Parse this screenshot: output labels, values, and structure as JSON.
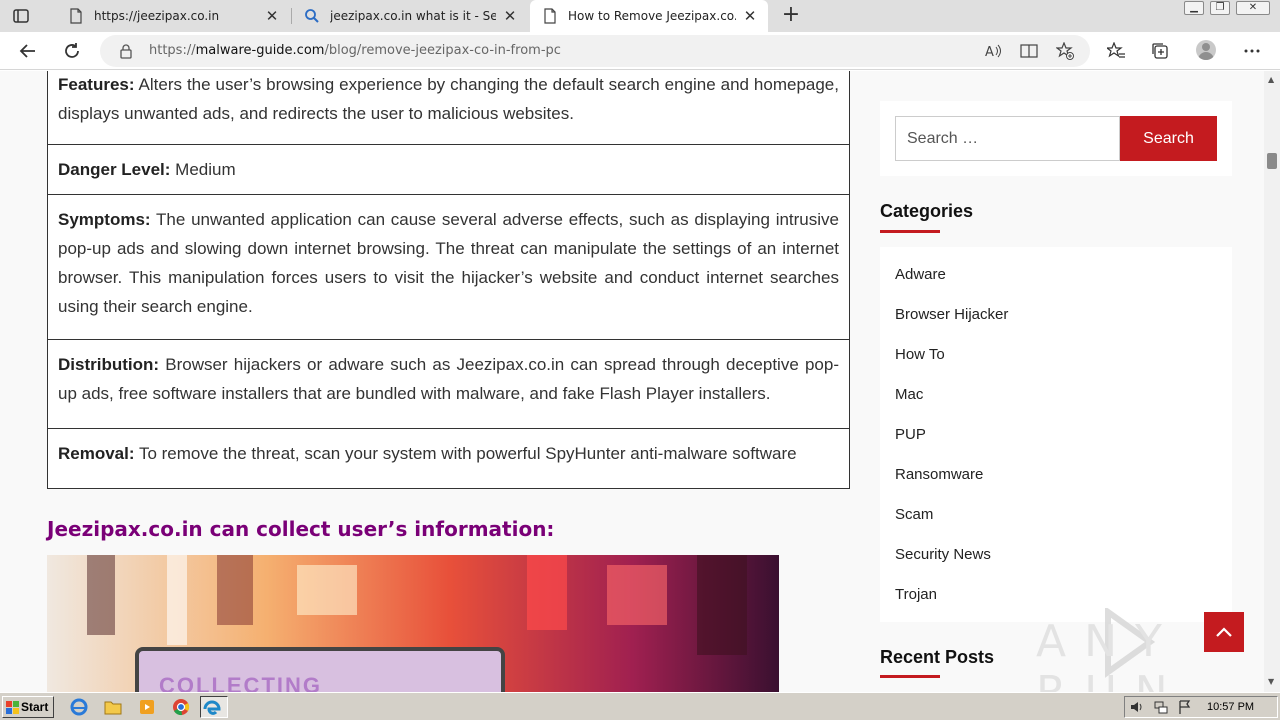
{
  "browser": {
    "tabs": [
      {
        "title": "https://jeezipax.co.in",
        "icon": "page-icon",
        "active": false
      },
      {
        "title": "jeezipax.co.in what is it - Search",
        "icon": "search-icon",
        "active": false
      },
      {
        "title": "How to Remove Jeezipax.co.in f",
        "icon": "page-icon",
        "active": true
      }
    ],
    "new_tab_label": "+",
    "url_prefix": "https://",
    "url_host": "malware-guide.com",
    "url_path": "/blog/remove-jeezipax-co-in-from-pc"
  },
  "article": {
    "rows": [
      {
        "label": "Features:",
        "text": "Alters the user’s browsing experience by changing the default search engine and homepage, displays unwanted ads, and redirects the user to malicious websites."
      },
      {
        "label": "Danger Level:",
        "text": "Medium"
      },
      {
        "label": "Symptoms:",
        "text": "The unwanted application can cause several adverse effects, such as displaying intrusive pop-up ads and slowing down internet browsing. The threat can manipulate the settings of an internet browser. This manipulation forces users to visit the hijacker’s website and conduct internet searches using their search engine."
      },
      {
        "label": "Distribution:",
        "text": "Browser hijackers or adware such as Jeezipax.co.in can spread through deceptive pop-up ads, free software installers that are bundled with malware, and fake Flash Player installers."
      },
      {
        "label": "Removal:",
        "text": "To remove the threat, scan your system with powerful SpyHunter anti-malware software"
      }
    ],
    "heading": "Jeezipax.co.in can collect user’s information:",
    "image_text": "COLLECTING"
  },
  "sidebar": {
    "search_placeholder": "Search …",
    "search_button": "Search",
    "categories_title": "Categories",
    "categories": [
      "Adware",
      "Browser Hijacker",
      "How To",
      "Mac",
      "PUP",
      "Ransomware",
      "Scam",
      "Security News",
      "Trojan"
    ],
    "recent_posts_title": "Recent Posts"
  },
  "watermark": "ANY RUN",
  "taskbar": {
    "start_label": "Start",
    "clock": "10:57 PM"
  },
  "colors": {
    "accent": "#c41b1f",
    "heading": "#7a0077"
  }
}
